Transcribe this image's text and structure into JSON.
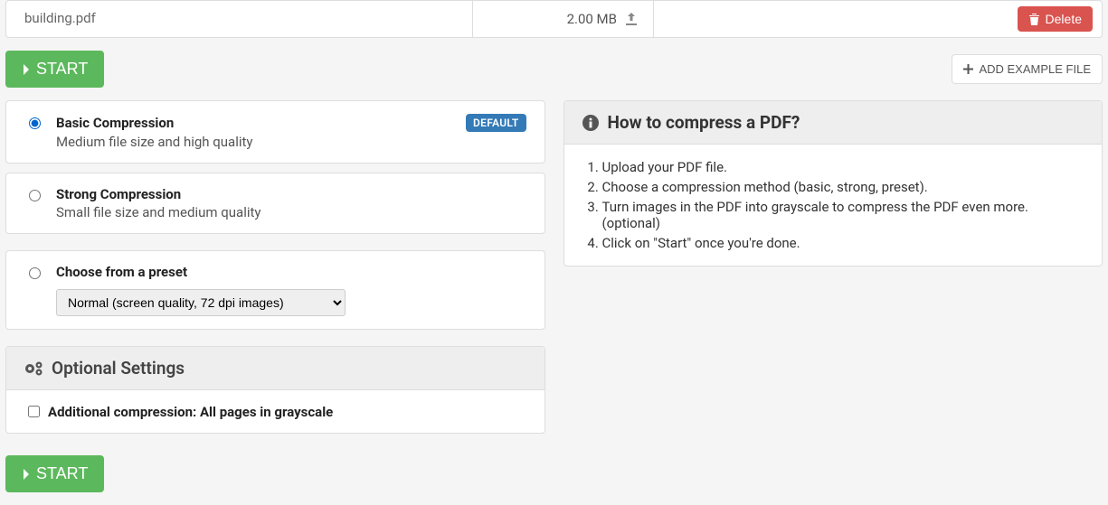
{
  "file": {
    "name": "building.pdf",
    "size": "2.00 MB"
  },
  "buttons": {
    "delete": "Delete",
    "start": "START",
    "add_example": "ADD EXAMPLE FILE"
  },
  "options": {
    "basic": {
      "title": "Basic Compression",
      "desc": "Medium file size and high quality",
      "badge": "DEFAULT"
    },
    "strong": {
      "title": "Strong Compression",
      "desc": "Small file size and medium quality"
    },
    "preset": {
      "title": "Choose from a preset",
      "selected": "Normal (screen quality, 72 dpi images)"
    }
  },
  "optional": {
    "header": "Optional Settings",
    "grayscale": "Additional compression: All pages in grayscale"
  },
  "info": {
    "header": "How to compress a PDF?",
    "steps": [
      "Upload your PDF file.",
      "Choose a compression method (basic, strong, preset).",
      "Turn images in the PDF into grayscale to compress the PDF even more. (optional)",
      "Click on \"Start\" once you're done."
    ]
  }
}
